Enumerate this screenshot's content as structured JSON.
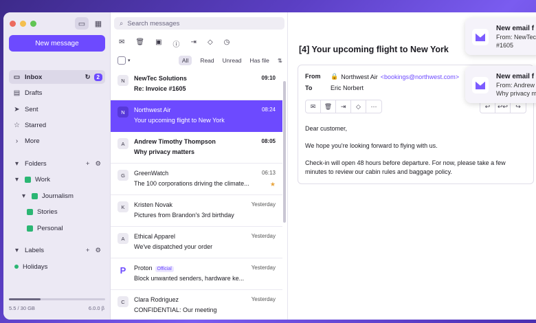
{
  "sidebar": {
    "new_message": "New message",
    "items": [
      {
        "label": "Inbox",
        "count": "2"
      },
      {
        "label": "Drafts"
      },
      {
        "label": "Sent"
      },
      {
        "label": "Starred"
      },
      {
        "label": "More"
      }
    ],
    "folders_label": "Folders",
    "folders": [
      "Work",
      "Journalism",
      "Stories",
      "Personal"
    ],
    "labels_label": "Labels",
    "labels": [
      "Holidays"
    ],
    "storage_text": "5.5 / 30 GB",
    "storage_fraction": 0.33,
    "version": "6.0.0 β"
  },
  "search": {
    "placeholder": "Search messages"
  },
  "filters": {
    "all": "All",
    "read": "Read",
    "unread": "Unread",
    "has_file": "Has file"
  },
  "messages": [
    {
      "initial": "N",
      "sender": "NewTec Solutions",
      "subject": "Re: Invoice #1605",
      "time": "09:10"
    },
    {
      "initial": "N",
      "sender": "Northwest Air",
      "subject": "Your upcoming flight to New York",
      "time": "08:24"
    },
    {
      "initial": "A",
      "sender": "Andrew Timothy Thompson",
      "subject": "Why privacy matters",
      "time": "08:05"
    },
    {
      "initial": "G",
      "sender": "GreenWatch",
      "subject": "The 100 corporations driving the climate...",
      "time": "06:13"
    },
    {
      "initial": "K",
      "sender": "Kristen Novak",
      "subject": "Pictures from Brandon's 3rd birthday",
      "time": "Yesterday"
    },
    {
      "initial": "A",
      "sender": "Ethical Apparel",
      "subject": "We've dispatched your order",
      "time": "Yesterday"
    },
    {
      "initial": "",
      "sender": "Proton",
      "official": "Official",
      "subject": "Block unwanted senders, hardware ke...",
      "time": "Yesterday"
    },
    {
      "initial": "C",
      "sender": "Clara Rodriguez",
      "subject": "CONFIDENTIAL: Our meeting",
      "time": "Yesterday"
    }
  ],
  "reader": {
    "title": "[4] Your upcoming flight to New York",
    "from_label": "From",
    "from_name": "Northwest Air",
    "from_email": "<bookings@northwest.com>",
    "to_label": "To",
    "to_name": "Eric Norbert",
    "body": [
      "Dear customer,",
      "We hope you're looking forward to flying with us.",
      "Check-in will open 48 hours before departure. For now, please take a few minutes to review our cabin rules and baggage policy."
    ]
  },
  "notifications": [
    {
      "title": "New email f",
      "line1": "From: NewTec",
      "line2": "#1605"
    },
    {
      "title": "New email f",
      "line1": "From: Andrew",
      "line2": "Why privacy m"
    }
  ]
}
